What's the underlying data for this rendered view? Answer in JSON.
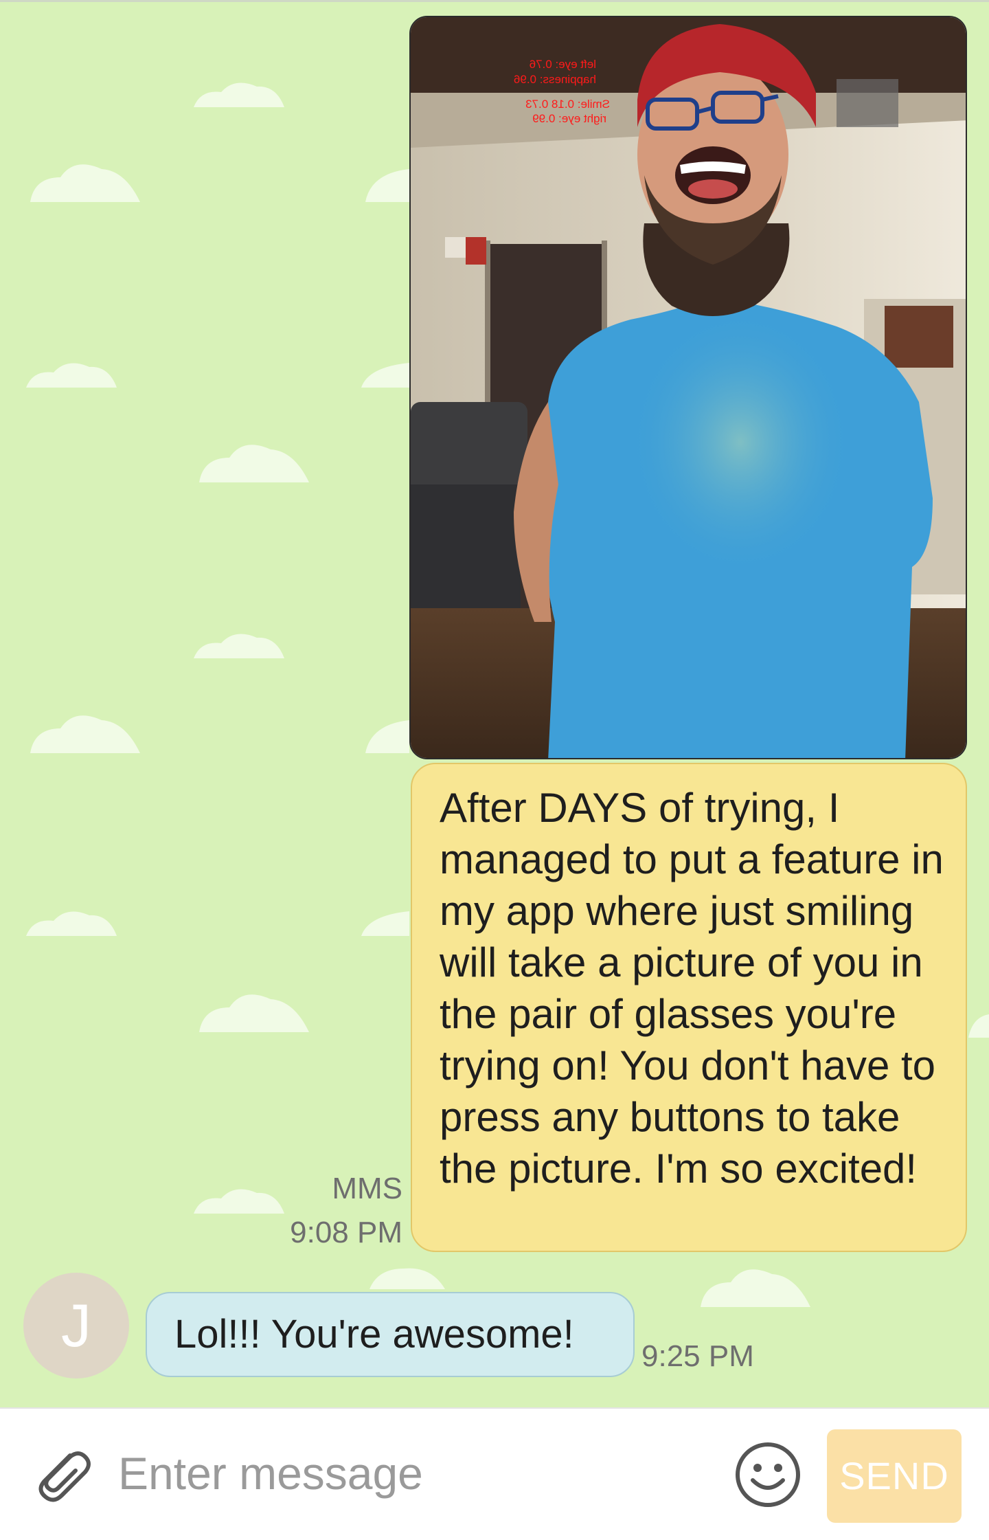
{
  "conversation": {
    "outgoing": {
      "message": "After DAYS of trying, I managed to put a feature in my app where just smiling will take a picture of you in the pair of glasses you're trying on! You don't have to press any buttons to take the picture. I'm so excited!",
      "type_label": "MMS",
      "time": "9:08 PM",
      "photo_overlay": {
        "left_eye": "left eye: 0.76",
        "happiness": "happiness: 0.96",
        "smile": "Smile: 0.18 0.73",
        "right_eye": "right eye: 0.99"
      }
    },
    "incoming": {
      "avatar_initial": "J",
      "message": "Lol!!! You're awesome!",
      "time": "9:25 PM"
    }
  },
  "composer": {
    "placeholder": "Enter message",
    "send_label": "SEND",
    "attach_icon": "paperclip-icon",
    "emoji_icon": "smiley-icon"
  },
  "colors": {
    "background": "#d8f2b8",
    "outgoing_bubble": "#f8e693",
    "incoming_bubble": "#d2ecef",
    "send_button": "#fbe0a6",
    "avatar": "#dfd6c6"
  }
}
